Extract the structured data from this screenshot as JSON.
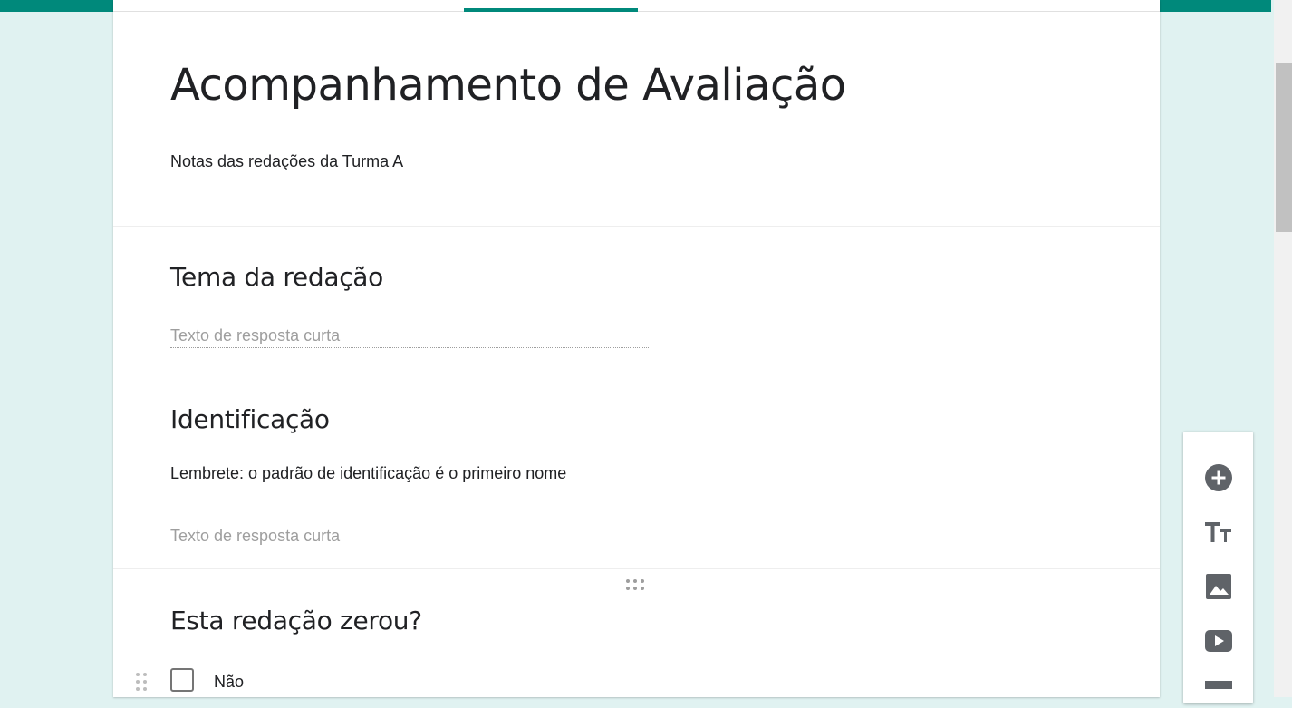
{
  "form": {
    "title": "Acompanhamento de Avaliação",
    "description": "Notas das redações da Turma A"
  },
  "questions": [
    {
      "title": "Tema da redação",
      "answer_placeholder": "Texto de resposta curta"
    },
    {
      "title": "Identificação",
      "description": "Lembrete: o padrão de identificação é o primeiro nome",
      "answer_placeholder": "Texto de resposta curta"
    },
    {
      "title": "Esta redação zerou?",
      "options": [
        "Não"
      ]
    }
  ],
  "toolbar": {
    "icons": [
      "add-question-icon",
      "add-title-icon",
      "add-image-icon",
      "add-video-icon",
      "add-section-icon"
    ]
  },
  "colors": {
    "accent": "#00897b",
    "page_background": "#e0f2f1",
    "icon": "#5f6368"
  }
}
